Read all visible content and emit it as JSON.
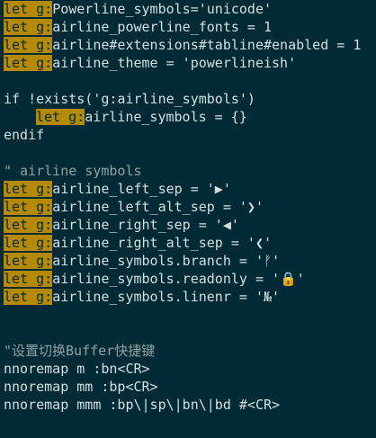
{
  "lines": [
    {
      "kind": "let",
      "prefix": "let g:",
      "rest": "Powerline_symbols='unicode'"
    },
    {
      "kind": "let",
      "prefix": "let g:",
      "rest": "airline_powerline_fonts = 1"
    },
    {
      "kind": "let",
      "prefix": "let g:",
      "rest": "airline#extensions#tabline#enabled = 1"
    },
    {
      "kind": "let",
      "prefix": "let g:",
      "rest": "airline_theme = 'powerlineish'"
    },
    {
      "kind": "blank"
    },
    {
      "kind": "text",
      "text": "if !exists('g:airline_symbols')"
    },
    {
      "kind": "let-indent",
      "prefix": "let g:",
      "rest": "airline_symbols = {}"
    },
    {
      "kind": "text",
      "text": "endif"
    },
    {
      "kind": "blank"
    },
    {
      "kind": "comment",
      "text": "\" airline symbols"
    },
    {
      "kind": "let",
      "prefix": "let g:",
      "rest": "airline_left_sep = '▶'"
    },
    {
      "kind": "let",
      "prefix": "let g:",
      "rest": "airline_left_alt_sep = '❯'"
    },
    {
      "kind": "let",
      "prefix": "let g:",
      "rest": "airline_right_sep = '◀'"
    },
    {
      "kind": "let",
      "prefix": "let g:",
      "rest": "airline_right_alt_sep = '❮'"
    },
    {
      "kind": "let",
      "prefix": "let g:",
      "rest": "airline_symbols.branch = 'ᚠ'"
    },
    {
      "kind": "let",
      "prefix": "let g:",
      "rest": "airline_symbols.readonly = '🔒'"
    },
    {
      "kind": "let",
      "prefix": "let g:",
      "rest": "airline_symbols.linenr = '№'"
    },
    {
      "kind": "blank"
    },
    {
      "kind": "blank"
    },
    {
      "kind": "comment",
      "text": "\"设置切换Buffer快捷键"
    },
    {
      "kind": "text",
      "text": "nnoremap m :bn<CR>"
    },
    {
      "kind": "text",
      "text": "nnoremap mm :bp<CR>"
    },
    {
      "kind": "text",
      "text": "nnoremap mmm :bp\\|sp\\|bn\\|bd #<CR>"
    }
  ],
  "colors": {
    "background": "#002b36",
    "keyword_highlight": "#b58900",
    "foreground": "#d5dfe0",
    "comment": "#93a1a1"
  }
}
